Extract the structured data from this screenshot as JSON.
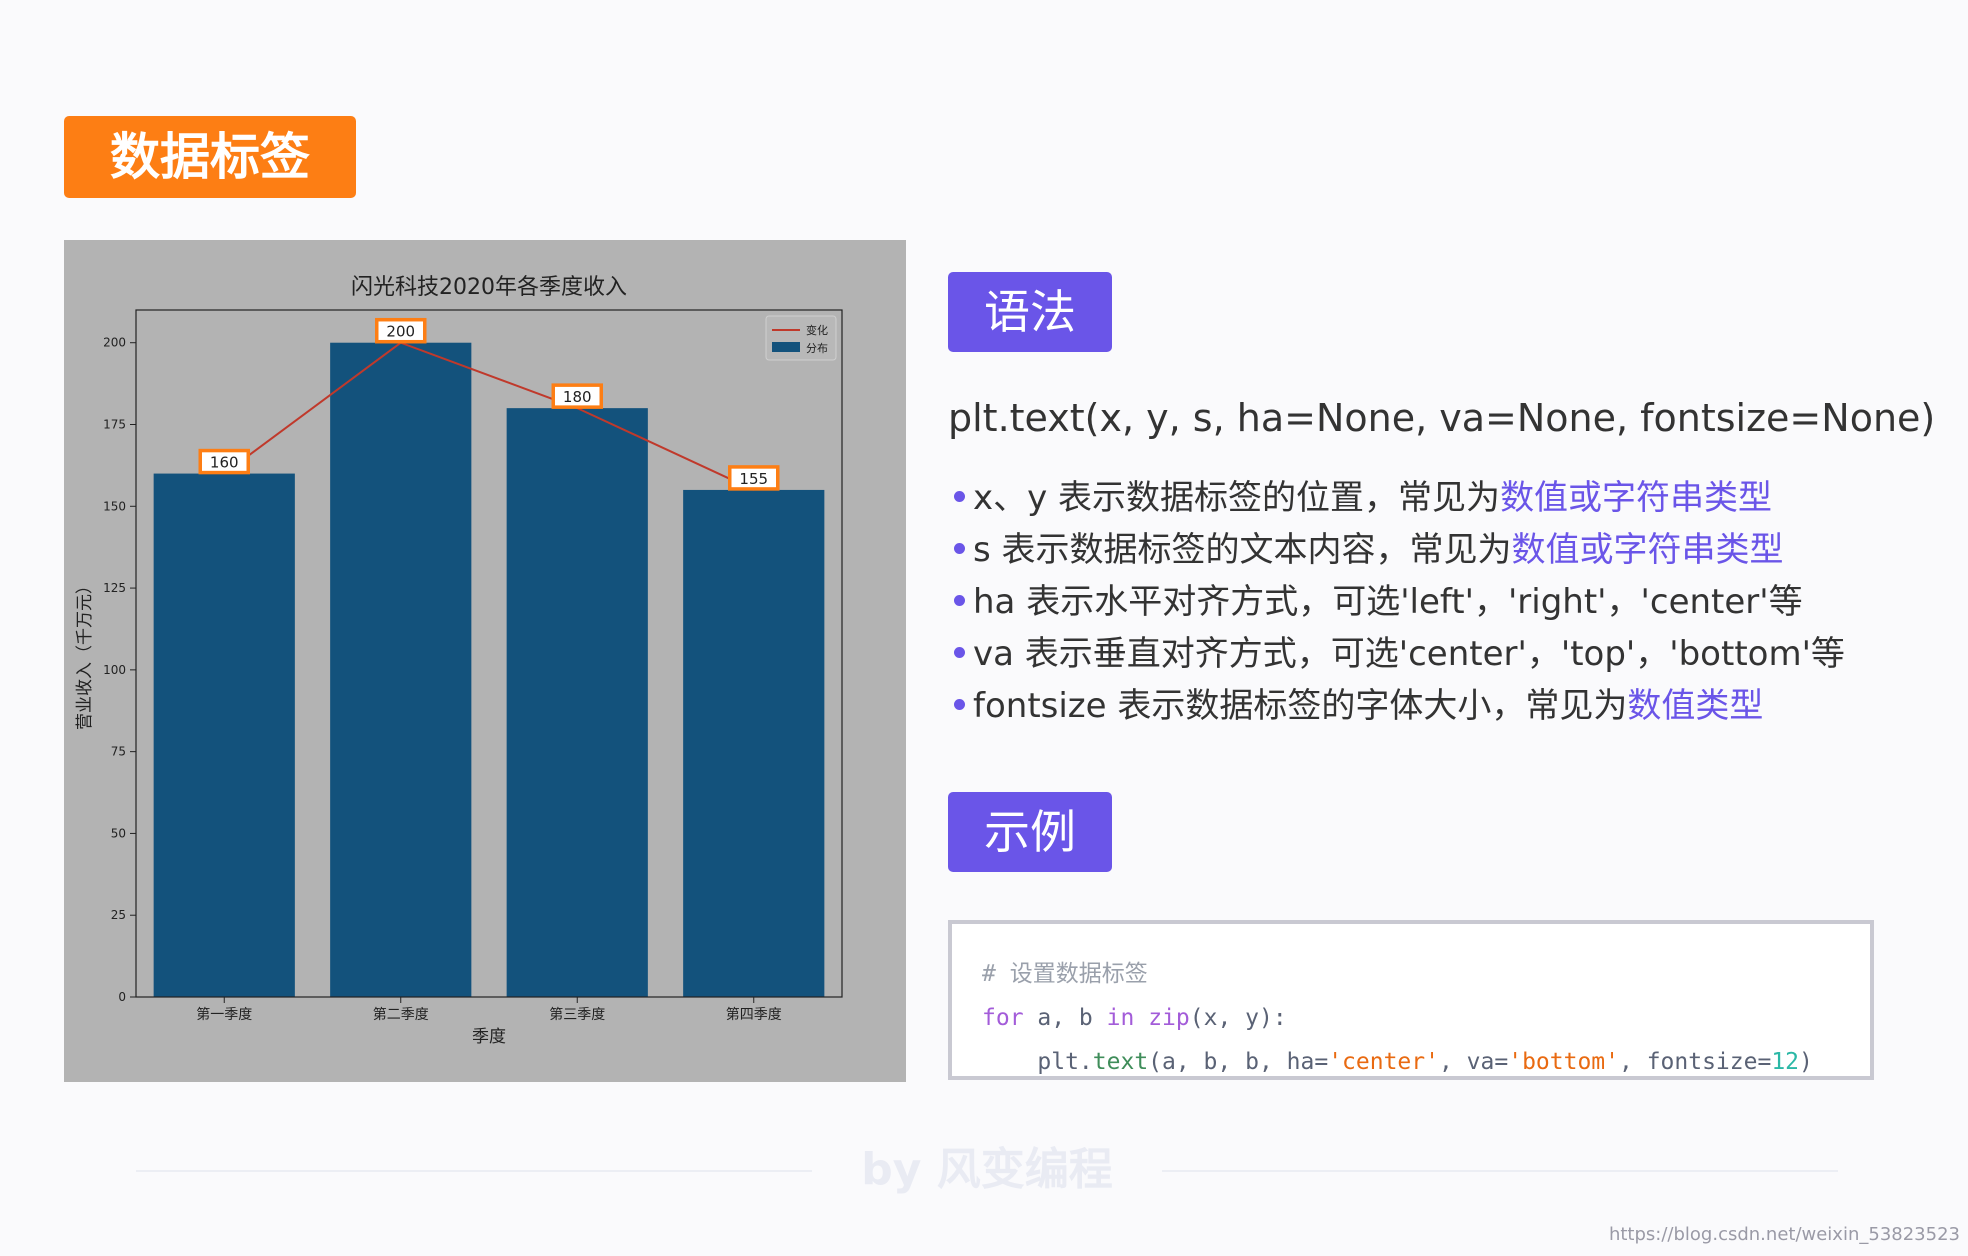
{
  "page": {
    "title": "数据标签",
    "syntax_label": "语法",
    "example_label": "示例",
    "signature": "plt.text(x, y, s, ha=None, va=None, fontsize=None)",
    "bullets": [
      {
        "text": "x、y 表示数据标签的位置，常见为",
        "highlight": "数值或字符串类型"
      },
      {
        "text": "s 表示数据标签的文本内容，常见为",
        "highlight": "数值或字符串类型"
      },
      {
        "text": "ha 表示水平对齐方式，可选'left'，'right'，'center'等",
        "highlight": ""
      },
      {
        "text": "va 表示垂直对齐方式，可选'center'，'top'，'bottom'等",
        "highlight": ""
      },
      {
        "text": "fontsize 表示数据标签的字体大小，常见为",
        "highlight": "数值类型"
      }
    ],
    "code": {
      "comment": "# 设置数据标签",
      "kw_for": "for",
      "vars": " a, b ",
      "kw_in": "in",
      "fn_zip": "zip",
      "zip_args": "(x, y):",
      "indent_obj": "    plt.",
      "fn_text": "text",
      "args_open": "(a, b, b, ha=",
      "str_center": "'center'",
      "args_mid": ", va=",
      "str_bottom": "'bottom'",
      "args_fs": ", fontsize=",
      "num_12": "12",
      "args_close": ")"
    },
    "footer": "by 风变编程",
    "watermark": "https://blog.csdn.net/weixin_53823523",
    "colors": {
      "title_badge": "#fd7e14",
      "section_badge": "#6a55e8",
      "highlight": "#6a55e8",
      "bar": "#13527c",
      "line": "#c0392b",
      "label_border": "#fd7e14",
      "chart_bg": "#b3b3b3"
    }
  },
  "chart_data": {
    "type": "bar",
    "title": "闪光科技2020年各季度收入",
    "categories": [
      "第一季度",
      "第二季度",
      "第三季度",
      "第四季度"
    ],
    "xlabel": "季度",
    "ylabel": "营业收入（千万元）",
    "ylim": [
      0,
      210
    ],
    "yticks": [
      0,
      25,
      50,
      75,
      100,
      125,
      150,
      175,
      200
    ],
    "grid": false,
    "legend_position": "top-right",
    "series": [
      {
        "name": "变化",
        "type": "line",
        "values": [
          160,
          200,
          180,
          155
        ]
      },
      {
        "name": "分布",
        "type": "bar",
        "values": [
          160,
          200,
          180,
          155
        ]
      }
    ],
    "data_labels": [
      "160",
      "200",
      "180",
      "155"
    ]
  }
}
